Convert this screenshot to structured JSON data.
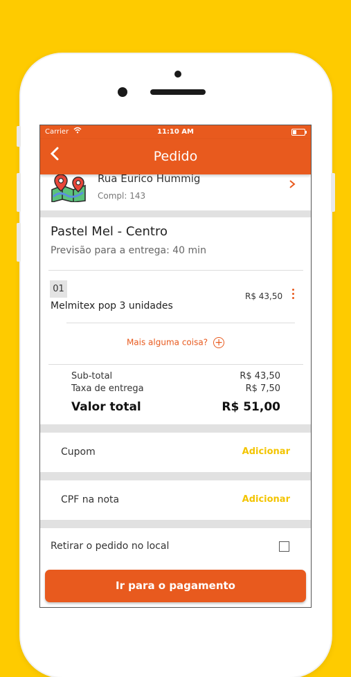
{
  "status_bar": {
    "carrier": "Carrier",
    "time": "11:10 AM"
  },
  "nav": {
    "title": "Pedido"
  },
  "address": {
    "street": "Rua Eurico Hummig",
    "complement": "Compl: 143"
  },
  "store": {
    "name": "Pastel Mel - Centro",
    "eta": "Previsão para a entrega: 40 min"
  },
  "items": [
    {
      "qty": "01",
      "name": "Melmitex pop 3 unidades",
      "price": "R$ 43,50"
    }
  ],
  "more_label": "Mais alguma coisa?",
  "summary": {
    "subtotal_label": "Sub-total",
    "subtotal_value": "R$ 43,50",
    "fee_label": "Taxa de entrega",
    "fee_value": "R$ 7,50",
    "total_label": "Valor total",
    "total_value": "R$ 51,00"
  },
  "options": {
    "coupon_label": "Cupom",
    "coupon_action": "Adicionar",
    "cpf_label": "CPF na nota",
    "cpf_action": "Adicionar"
  },
  "pickup_label": "Retirar o pedido no local",
  "pay_button": "Ir para o pagamento",
  "colors": {
    "brand": "#E85A1E",
    "accent": "#F3C400",
    "background": "#FECB00"
  }
}
